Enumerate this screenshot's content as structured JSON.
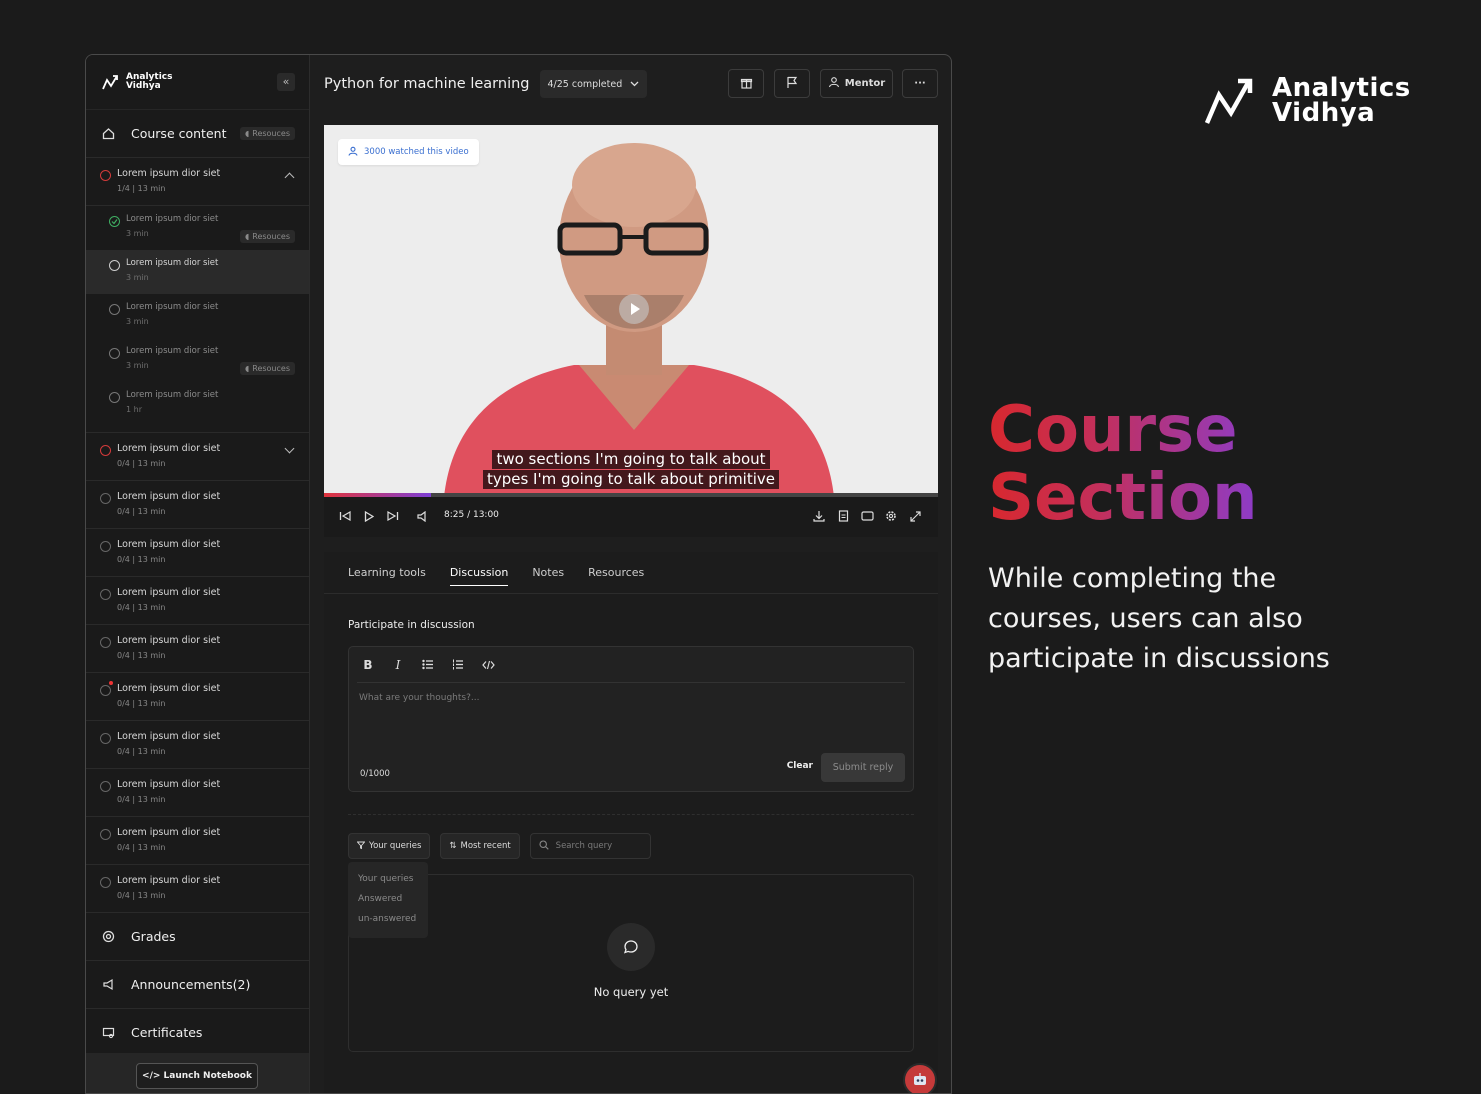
{
  "app": {
    "logo_text_line1": "Analytics",
    "logo_text_line2": "Vidhya",
    "course_title": "Python for machine learning",
    "progress": "4/25 completed",
    "mentor_label": "Mentor"
  },
  "sidebar": {
    "course_content": "Course content",
    "resources_chip": "Resouces",
    "modules": [
      {
        "title": "Lorem ipsum dior siet",
        "meta": "1/4 | 13 min",
        "expanded": true,
        "lessons": [
          {
            "title": "Lorem ipsum dior siet",
            "meta": "3 min",
            "resources": "Resouces",
            "state": "done"
          },
          {
            "title": "Lorem ipsum dior siet",
            "meta": "3 min",
            "state": "active"
          },
          {
            "title": "Lorem ipsum dior siet",
            "meta": "3 min",
            "state": "todo"
          },
          {
            "title": "Lorem ipsum dior siet",
            "meta": "3 min",
            "resources": "Resouces",
            "state": "todo"
          },
          {
            "title": "Lorem ipsum dior siet",
            "meta": "1 hr",
            "state": "todo"
          }
        ]
      },
      {
        "title": "Lorem ipsum dior siet",
        "meta": "0/4 | 13 min",
        "expanded": false
      },
      {
        "title": "Lorem ipsum dior siet",
        "meta": "0/4 | 13 min"
      },
      {
        "title": "Lorem ipsum dior siet",
        "meta": "0/4 | 13 min"
      },
      {
        "title": "Lorem ipsum dior siet",
        "meta": "0/4 | 13 min"
      },
      {
        "title": "Lorem ipsum dior siet",
        "meta": "0/4 | 13 min"
      },
      {
        "title": "Lorem ipsum dior siet",
        "meta": "0/4 | 13 min"
      },
      {
        "title": "Lorem ipsum dior siet",
        "meta": "0/4 | 13 min"
      },
      {
        "title": "Lorem ipsum dior siet",
        "meta": "0/4 | 13 min"
      },
      {
        "title": "Lorem ipsum dior siet",
        "meta": "0/4 | 13 min"
      },
      {
        "title": "Lorem ipsum dior siet",
        "meta": "0/4 | 13 min"
      }
    ],
    "grades": "Grades",
    "announcements": "Announcements(2)",
    "certificates": "Certificates",
    "launch_notebook": "Launch Notebook"
  },
  "video": {
    "watched": "3000 watched this video",
    "caption_line1": "two sections I'm going to talk about",
    "caption_line2": "types I'm going to talk about primitive",
    "time": "8:25 / 13:00",
    "progress_fraction": 0.175
  },
  "tabs": [
    "Learning tools",
    "Discussion",
    "Notes",
    "Resources"
  ],
  "discussion": {
    "heading": "Participate in discussion",
    "placeholder": "What are your thoughts?...",
    "counter": "0/1000",
    "clear": "Clear",
    "submit": "Submit reply",
    "filter_label": "Your queries",
    "sort_label": "Most recent",
    "search_placeholder": "Search query",
    "dropdown": [
      "Your queries",
      "Answered",
      "un-answered"
    ],
    "empty": "No query yet"
  },
  "marketing": {
    "brand_line1": "Analytics",
    "brand_line2": "Vidhya",
    "title_line1": "Course",
    "title_line2": "Section",
    "description": "While completing the courses, users can also participate in discussions"
  },
  "colors": {
    "accent_red": "#d8282e",
    "accent_purple": "#8d3cc8",
    "success_green": "#3fae62",
    "link_blue": "#3a6fd0"
  }
}
